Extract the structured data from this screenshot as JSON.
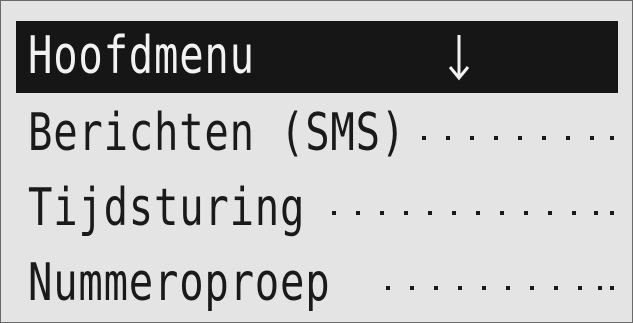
{
  "menu": {
    "title": "Hoofdmenu",
    "scroll_indicator_icon": "arrow-down-icon",
    "items": [
      {
        "label": "Berichten (SMS)",
        "leader": "dots"
      },
      {
        "label": "Tijdsturing",
        "leader": "dots"
      },
      {
        "label": "Nummeroproep",
        "leader": "dots"
      }
    ]
  },
  "colors": {
    "screen_background": "#e4e4e4",
    "text": "#1a1a1a",
    "highlight_background": "#161616",
    "highlight_text": "#f2f2f2"
  }
}
